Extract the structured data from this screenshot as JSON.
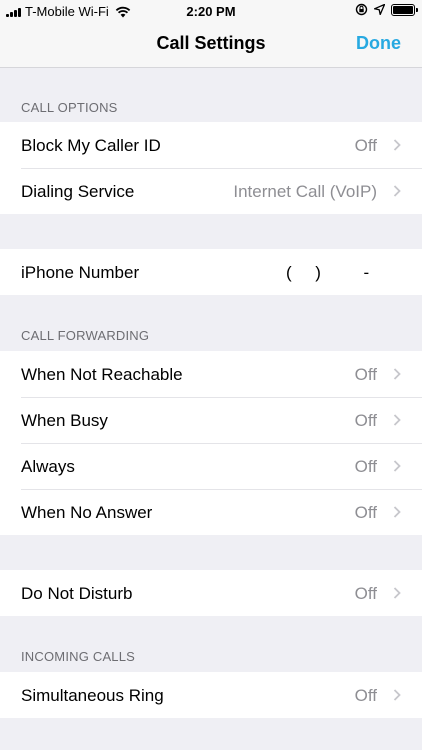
{
  "status_bar": {
    "carrier": "T-Mobile Wi-Fi",
    "time": "2:20 PM"
  },
  "nav": {
    "title": "Call Settings",
    "done_label": "Done"
  },
  "sections": {
    "call_options": {
      "header": "CALL OPTIONS",
      "rows": [
        {
          "label": "Block My Caller ID",
          "value": "Off"
        },
        {
          "label": "Dialing Service",
          "value": "Internet Call (VoIP)"
        }
      ]
    },
    "phone": {
      "label": "iPhone Number",
      "value": "(     )         -"
    },
    "call_forwarding": {
      "header": "CALL FORWARDING",
      "rows": [
        {
          "label": "When Not Reachable",
          "value": "Off"
        },
        {
          "label": "When Busy",
          "value": "Off"
        },
        {
          "label": "Always",
          "value": "Off"
        },
        {
          "label": "When No Answer",
          "value": "Off"
        }
      ]
    },
    "dnd": {
      "label": "Do Not Disturb",
      "value": "Off"
    },
    "incoming_calls": {
      "header": "INCOMING CALLS",
      "rows": [
        {
          "label": "Simultaneous Ring",
          "value": "Off"
        }
      ]
    }
  },
  "colors": {
    "accent": "#27a9e1",
    "background": "#efeff4",
    "secondary_text": "#8e8e93"
  },
  "icons": [
    "signal-icon",
    "wifi-icon",
    "lock-rotation-icon",
    "location-icon",
    "battery-icon",
    "chevron-right-icon"
  ]
}
